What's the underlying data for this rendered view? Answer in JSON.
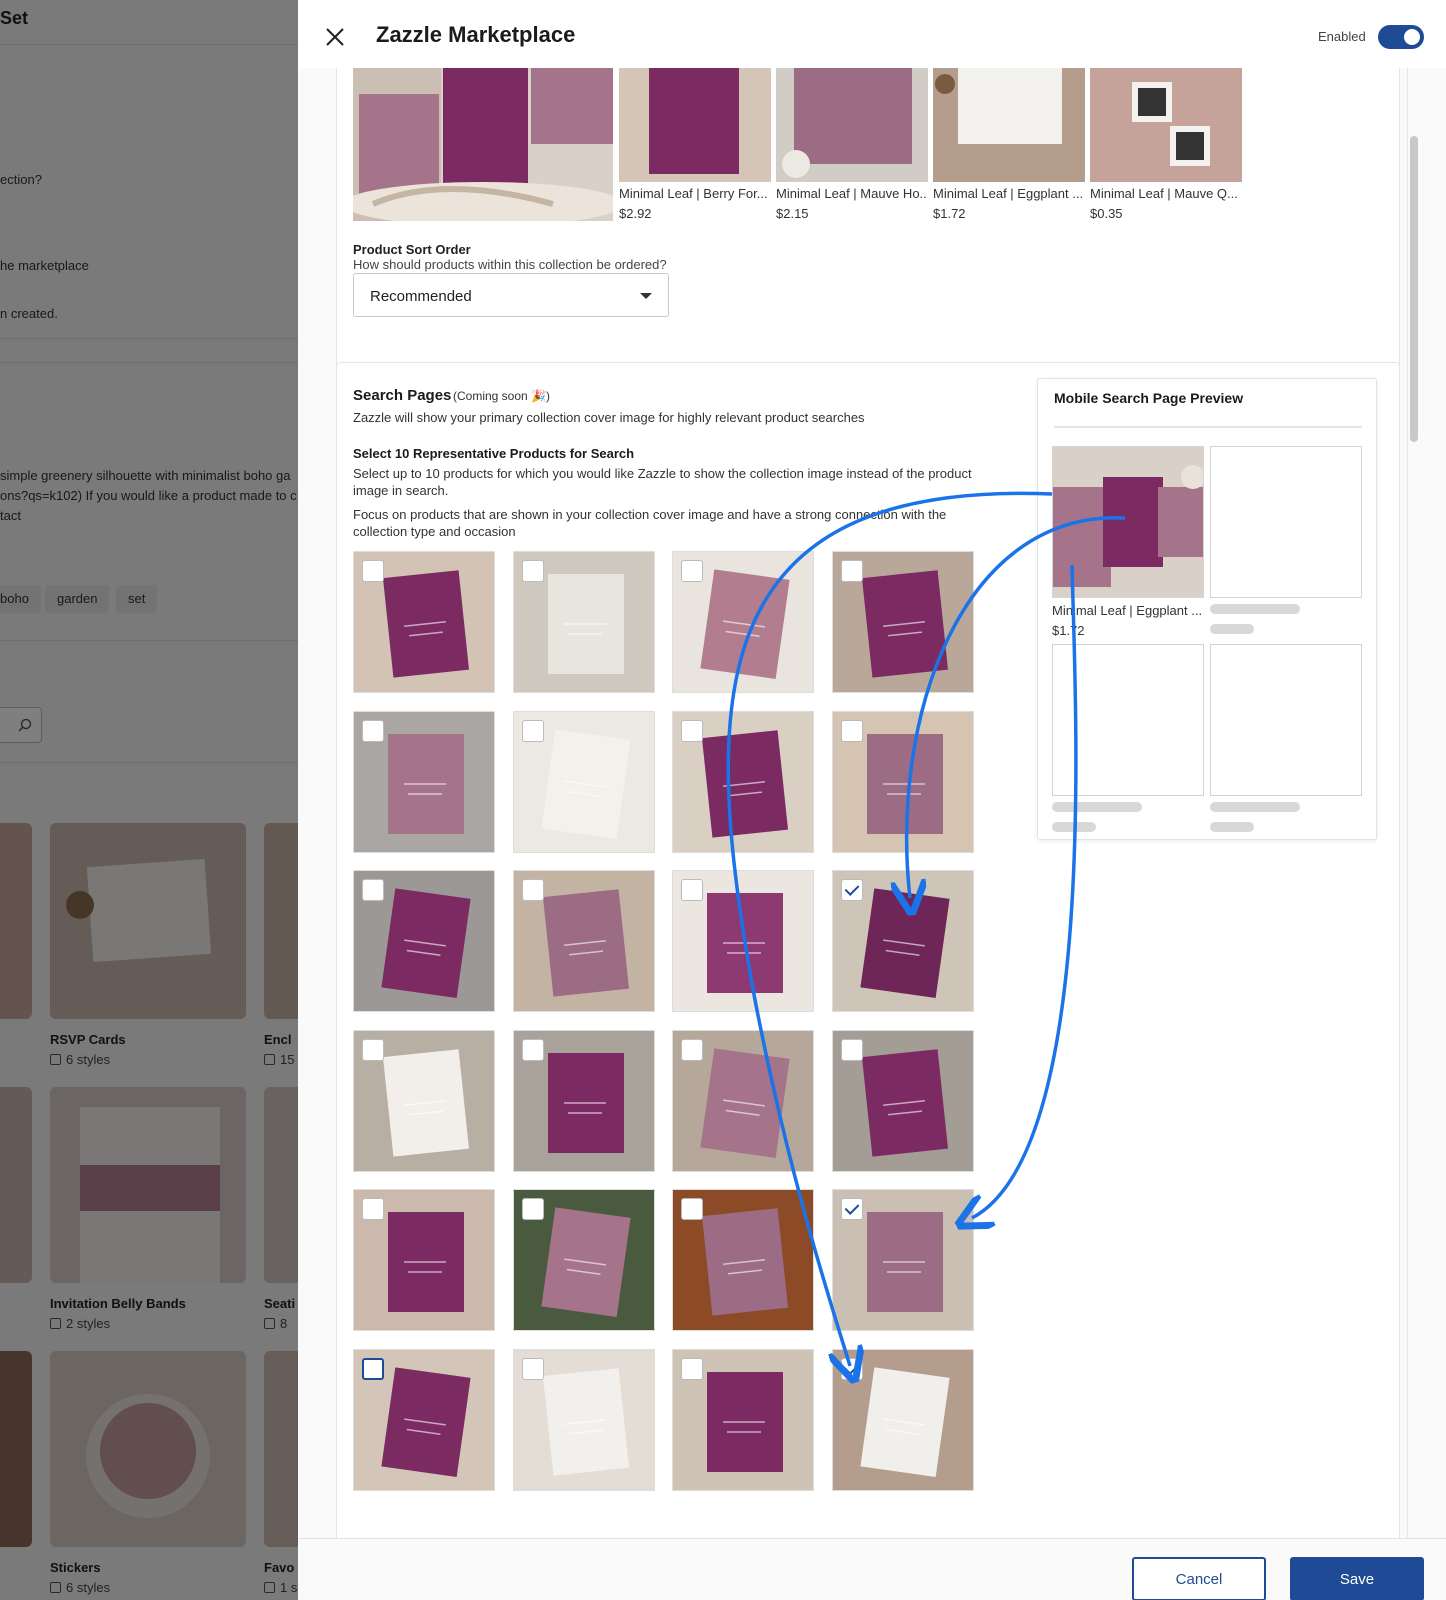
{
  "background": {
    "title": "Set",
    "lines": [
      "ection?",
      "he marketplace",
      "n created.",
      "simple greenery silhouette with minimalist boho ga",
      "ons?qs=k102) If you would like a product made to c",
      "tact"
    ],
    "tags": [
      "boho",
      "garden",
      "set"
    ],
    "cards": [
      {
        "label": "RSVP Cards",
        "styles": "6 styles"
      },
      {
        "label": "Encl",
        "styles": "15"
      },
      {
        "label": "Invitation Belly Bands",
        "styles": "2 styles"
      },
      {
        "label": "Seati",
        "styles": "8"
      },
      {
        "label": "Stickers",
        "styles": "6 styles"
      },
      {
        "label": "Favo",
        "styles": "1 s"
      }
    ]
  },
  "drawer": {
    "title": "Zazzle Marketplace",
    "enabled_label": "Enabled",
    "enabled": true
  },
  "collection_products": [
    {
      "name": "Minimal Leaf | Berry For...",
      "price": "$2.92"
    },
    {
      "name": "Minimal Leaf | Mauve Ho...",
      "price": "$2.15"
    },
    {
      "name": "Minimal Leaf | Eggplant ...",
      "price": "$1.72"
    },
    {
      "name": "Minimal Leaf | Mauve Q...",
      "price": "$0.35"
    }
  ],
  "sort": {
    "label": "Product Sort Order",
    "help": "How should products within this collection be ordered?",
    "value": "Recommended"
  },
  "search_pages": {
    "title": "Search Pages",
    "coming_soon": "(Coming soon 🎉)",
    "description": "Zazzle will show your primary collection cover image for highly relevant product searches",
    "select_title": "Select 10 Representative Products for Search",
    "select_desc_1": "Select up to 10 products for which you would like Zazzle to show the collection image instead of the product image in search.",
    "select_desc_2": "Focus on products that are shown in your collection cover image and have a strong connection with the collection type and occasion",
    "checked": [
      false,
      false,
      false,
      false,
      false,
      false,
      false,
      false,
      false,
      false,
      false,
      true,
      false,
      false,
      false,
      false,
      false,
      false,
      false,
      true,
      false,
      false,
      false,
      true
    ]
  },
  "preview": {
    "title": "Mobile Search Page Preview",
    "product_name": "Minimal Leaf | Eggplant ...",
    "product_price": "$1.72"
  },
  "footer": {
    "cancel": "Cancel",
    "save": "Save"
  },
  "colors": {
    "accent": "#1f4b96",
    "arrow": "#1a73e8",
    "plum": "#7b2a62",
    "mauve": "#9c6b84"
  }
}
